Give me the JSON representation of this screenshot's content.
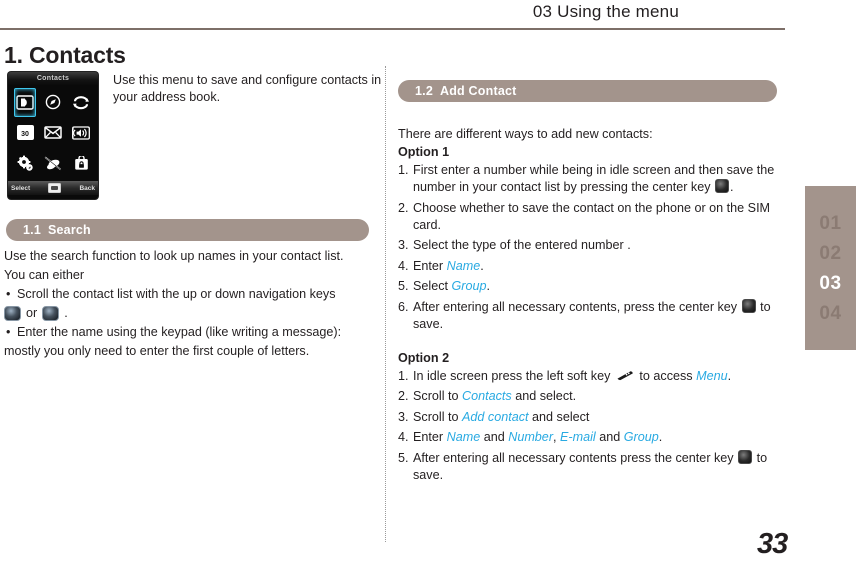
{
  "header": {
    "chapter_title": "03 Using the menu"
  },
  "sidebar": {
    "tabs": [
      {
        "label": "01",
        "active": false
      },
      {
        "label": "02",
        "active": false
      },
      {
        "label": "03",
        "active": true
      },
      {
        "label": "04",
        "active": false
      }
    ]
  },
  "page": {
    "title": "1. Contacts",
    "number": "33"
  },
  "phone": {
    "title": "Contacts",
    "icons": [
      "contacts-icon",
      "compass-icon",
      "sync-arrows-icon",
      "calendar-icon",
      "envelope-icon",
      "speaker-icon",
      "gear-icon",
      "tools-icon",
      "lock-briefcase-icon"
    ],
    "calendar_day": "30",
    "softkey_left": "Select",
    "softkey_right": "Back",
    "center_key": "center-key-icon"
  },
  "intro": {
    "text": "Use this menu to save and configure contacts in your address book."
  },
  "section_search": {
    "pill_number": "1.1",
    "pill_label": "Search",
    "line1": "Use the search function to look up names in your contact list.",
    "line2": "You can either",
    "bullet1": "Scroll the contact list with the up or down navigation keys",
    "navkey_or": "or",
    "navkey_period": ".",
    "bullet2_line1": "Enter the name using the keypad (like writing a message):",
    "bullet2_line2": "mostly you only need to enter the first couple of letters."
  },
  "section_add_contact": {
    "pill_number": "1.2",
    "pill_label": "Add Contact",
    "intro": "There are different ways to add new contacts:",
    "option1_head": "Option 1",
    "option1_steps": [
      {
        "index": "1.",
        "pre": "First enter a number while being in idle screen and then save the number in your contact list by pressing the center key ",
        "icon": "center-key-icon",
        "post": "."
      },
      {
        "index": "2.",
        "pre": "Choose whether to save the contact on the phone or on the SIM card.",
        "icon": "",
        "post": ""
      },
      {
        "index": "3.",
        "pre": "Select the type of the entered number .",
        "icon": "",
        "post": ""
      },
      {
        "index": "4.",
        "pre": "Enter ",
        "kw": "Name",
        "post": "."
      },
      {
        "index": "5.",
        "pre": "Select ",
        "kw": "Group",
        "post": "."
      },
      {
        "index": "6.",
        "pre": "After entering all necessary contents, press the center key ",
        "icon": "center-key-icon",
        "post": " to save."
      }
    ],
    "option2_head": "Option 2",
    "option2_steps": [
      {
        "index": "1.",
        "pre": "In idle screen press the left soft key ",
        "icon": "soft-key-icon",
        "mid": " to access ",
        "kw": "Menu",
        "post": "."
      },
      {
        "index": "2.",
        "pre": "Scroll to ",
        "kw": "Contacts",
        "post": " and select."
      },
      {
        "index": "3.",
        "pre": "Scroll to ",
        "kw": "Add contact",
        "post": "  and select"
      },
      {
        "index": "4.",
        "pre": "Enter ",
        "kw": "Name",
        "mid": " and ",
        "kw2": "Number",
        "mid2": ", ",
        "kw3": "E-mail",
        "mid3": " and ",
        "kw4": "Group",
        "post": "."
      },
      {
        "index": "5.",
        "pre": "After entering all necessary contents press the center key ",
        "icon": "center-key-icon",
        "post": " to save."
      }
    ]
  },
  "colors": {
    "accent_taupe": "#a3948c",
    "keyword_cyan": "#29aae2",
    "rule": "#7d6f68",
    "text": "#231f20"
  }
}
